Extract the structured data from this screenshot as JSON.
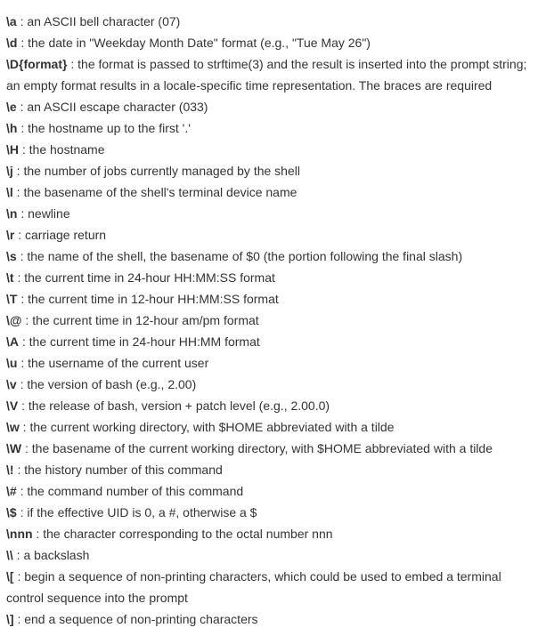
{
  "separator": " : ",
  "items": [
    {
      "code": "\\a",
      "desc": "an ASCII bell character (07)"
    },
    {
      "code": "\\d",
      "desc": "the date in \"Weekday Month Date\" format (e.g., \"Tue May 26\")"
    },
    {
      "code": "\\D{format}",
      "desc": "the format is passed to strftime(3) and the result is inserted into the prompt string; an empty format results in a locale-specific time representation. The braces are required"
    },
    {
      "code": "\\e",
      "desc": "an ASCII escape character (033)"
    },
    {
      "code": "\\h",
      "desc": "the hostname up to the first '.'"
    },
    {
      "code": "\\H",
      "desc": "the hostname"
    },
    {
      "code": "\\j",
      "desc": "the number of jobs currently managed by the shell"
    },
    {
      "code": "\\l",
      "desc": "the basename of the shell's terminal device name"
    },
    {
      "code": "\\n",
      "desc": "newline"
    },
    {
      "code": "\\r",
      "desc": "carriage return"
    },
    {
      "code": "\\s",
      "desc": "the name of the shell, the basename of $0 (the portion following the final slash)"
    },
    {
      "code": "\\t",
      "desc": "the current time in 24-hour HH:MM:SS format"
    },
    {
      "code": "\\T",
      "desc": "the current time in 12-hour HH:MM:SS format"
    },
    {
      "code": "\\@",
      "desc": "the current time in 12-hour am/pm format"
    },
    {
      "code": "\\A",
      "desc": "the current time in 24-hour HH:MM format"
    },
    {
      "code": "\\u",
      "desc": "the username of the current user"
    },
    {
      "code": "\\v",
      "desc": "the version of bash (e.g., 2.00)"
    },
    {
      "code": "\\V",
      "desc": "the release of bash, version + patch level (e.g., 2.00.0)"
    },
    {
      "code": "\\w",
      "desc": "the current working directory, with $HOME abbreviated with a tilde"
    },
    {
      "code": "\\W",
      "desc": "the basename of the current working directory, with $HOME abbreviated with a tilde"
    },
    {
      "code": "\\!",
      "desc": "the history number of this command"
    },
    {
      "code": "\\#",
      "desc": "the command number of this command"
    },
    {
      "code": "\\$",
      "desc": "if the effective UID is 0, a #, otherwise a $"
    },
    {
      "code": "\\nnn",
      "desc": "the character corresponding to the octal number nnn"
    },
    {
      "code": "\\\\",
      "desc": "a backslash"
    },
    {
      "code": "\\[",
      "desc": "begin a sequence of non-printing characters, which could be used to embed a terminal control sequence into the prompt"
    },
    {
      "code": "\\]",
      "desc": "end a sequence of non-printing characters"
    }
  ]
}
